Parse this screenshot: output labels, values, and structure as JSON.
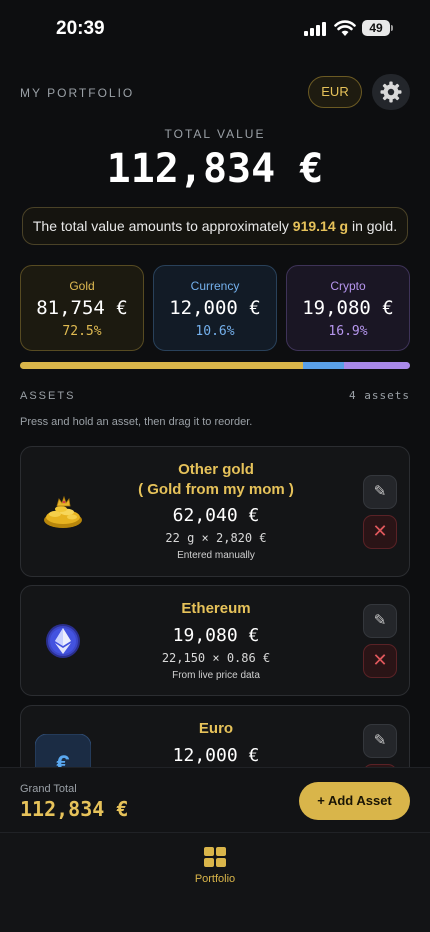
{
  "status_bar": {
    "time": "20:39",
    "battery": "49"
  },
  "header": {
    "title": "MY PORTFOLIO",
    "currency": "EUR"
  },
  "summary": {
    "total_label": "TOTAL VALUE",
    "total_value": "112,834 €",
    "gold_note_pre": "The total value amounts to approximately ",
    "gold_note_amount": "919.14 g",
    "gold_note_post": " in gold."
  },
  "categories": [
    {
      "label": "Gold",
      "value": "81,754 €",
      "percent": "72.5%",
      "color": "#d9b54a"
    },
    {
      "label": "Currency",
      "value": "12,000 €",
      "percent": "10.6%",
      "color": "#5aa0e8"
    },
    {
      "label": "Crypto",
      "value": "19,080 €",
      "percent": "16.9%",
      "color": "#a989ea"
    }
  ],
  "allocation": [
    0.725,
    0.106,
    0.169
  ],
  "assets_section": {
    "label": "ASSETS",
    "count": "4 assets",
    "hint": "Press and hold an asset, then drag it to reorder."
  },
  "assets": [
    {
      "name": "Other gold",
      "subname": "( Gold from my mom )",
      "amount": "62,040 €",
      "calc": "22 g × 2,820 €",
      "source": "Entered manually",
      "icon": "gold-coins-icon"
    },
    {
      "name": "Ethereum",
      "subname": "",
      "amount": "19,080 €",
      "calc": "22,150 × 0.86 €",
      "source": "From live price data",
      "icon": "ethereum-icon"
    },
    {
      "name": "Euro",
      "subname": "",
      "amount": "12,000 €",
      "calc": "",
      "source": "",
      "icon": "euro-icon"
    }
  ],
  "footer": {
    "grand_total_label": "Grand Total",
    "grand_total_value": "112,834 €",
    "add_label": "+ Add Asset"
  },
  "tabbar": {
    "portfolio_label": "Portfolio",
    "icon": "grid-icon"
  }
}
